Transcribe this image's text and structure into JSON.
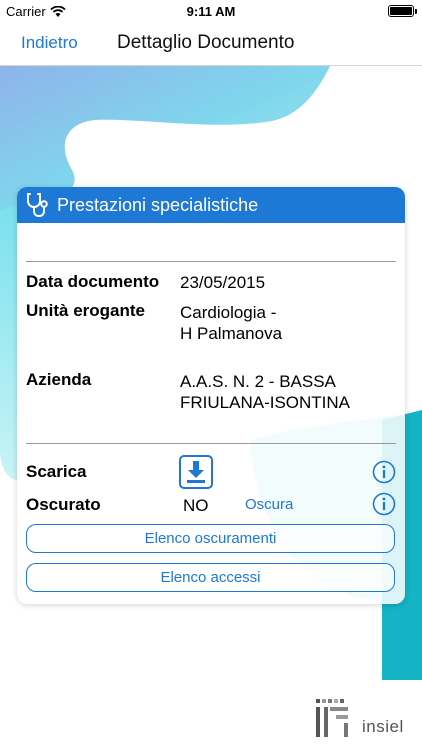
{
  "status_bar": {
    "carrier": "Carrier",
    "time": "9:11 AM"
  },
  "nav": {
    "back_label": "Indietro",
    "title": "Dettaglio Documento"
  },
  "card": {
    "title": "Prestazioni specialistiche",
    "fields": [
      {
        "label": "Data documento",
        "value": "23/05/2015"
      },
      {
        "label": "Unità erogante",
        "value_lines": [
          "Cardiologia -",
          "H Palmanova"
        ]
      },
      {
        "label": "Azienda",
        "value_lines": [
          "A.A.S. N. 2 - BASSA",
          "FRIULANA-ISONTINA"
        ]
      }
    ],
    "scarica_label": "Scarica",
    "oscurato_label": "Oscurato",
    "oscurato_value": "NO",
    "oscura_link": "Oscura",
    "elenco_oscuramenti": "Elenco oscuramenti",
    "elenco_accessi": "Elenco accessi"
  },
  "logo": {
    "text": "insiel"
  },
  "colors": {
    "accent": "#1e78d6",
    "teal": "#13b5c8"
  }
}
